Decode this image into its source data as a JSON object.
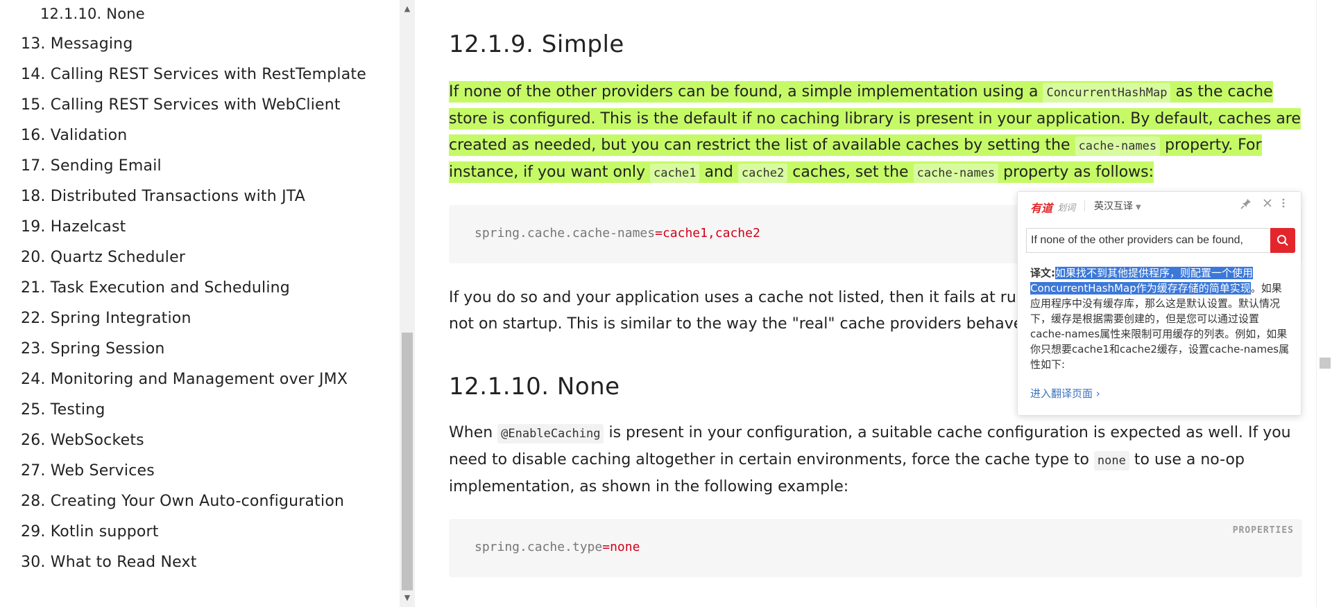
{
  "toc": {
    "items": [
      {
        "label": "12.1.10. None",
        "sub": true
      },
      {
        "label": "13. Messaging"
      },
      {
        "label": "14. Calling REST Services with RestTemplate"
      },
      {
        "label": "15. Calling REST Services with WebClient"
      },
      {
        "label": "16. Validation"
      },
      {
        "label": "17. Sending Email"
      },
      {
        "label": "18. Distributed Transactions with JTA"
      },
      {
        "label": "19. Hazelcast"
      },
      {
        "label": "20. Quartz Scheduler"
      },
      {
        "label": "21. Task Execution and Scheduling"
      },
      {
        "label": "22. Spring Integration"
      },
      {
        "label": "23. Spring Session"
      },
      {
        "label": "24. Monitoring and Management over JMX"
      },
      {
        "label": "25. Testing"
      },
      {
        "label": "26. WebSockets"
      },
      {
        "label": "27. Web Services"
      },
      {
        "label": "28. Creating Your Own Auto-configuration"
      },
      {
        "label": "29. Kotlin support"
      },
      {
        "label": "30. What to Read Next"
      }
    ]
  },
  "main": {
    "simple": {
      "heading": "12.1.9. Simple",
      "para1": {
        "t1": "If none of the other providers can be found, a simple implementation using a ",
        "c1": "ConcurrentHashMap",
        "t2": " as the cache store is configured. This is the default if no caching library is present in your application. By default, caches are created as needed, but you can restrict the list of available caches by setting the ",
        "c2": "cache-names",
        "t3": " property. For instance, if you want only ",
        "c3": "cache1",
        "t4": " and ",
        "c4": "cache2",
        "t5": " caches, set the ",
        "c5": "cache-names",
        "t6": " property as follows:"
      },
      "code": {
        "key": "spring.cache.cache-names",
        "eq": "=",
        "value": "cache1,cache2"
      },
      "para2": "If you do so and your application uses a cache not listed, then it fails at runtime when the cache is needed, but not on startup. This is similar to the way the \"real\" cache providers behave if you use an undeclared cache."
    },
    "none": {
      "heading": "12.1.10. None",
      "para": {
        "t1": "When ",
        "c1": "@EnableCaching",
        "t2": " is present in your configuration, a suitable cache configuration is expected as well. If you need to disable caching altogether in certain environments, force the cache type to ",
        "c2": "none",
        "t3": " to use a no-op implementation, as shown in the following example:"
      },
      "code": {
        "lang": "PROPERTIES",
        "key": "spring.cache.type",
        "eq": "=",
        "value": "none"
      }
    }
  },
  "popup": {
    "logo": "有道",
    "logo_sub": "划词",
    "mode": "英汉互译",
    "search_value": "If none of the other providers can be found,",
    "translation_label": "译文:",
    "translation_selected": "如果找不到其他提供程序，则配置一个使用ConcurrentHashMap作为缓存存储的简单实现",
    "translation_rest": "。如果应用程序中没有缓存库，那么这是默认设置。默认情况下，缓存是根据需要创建的，但是您可以通过设置cache-names属性来限制可用缓存的列表。例如，如果你只想要cache1和cache2缓存，设置cache-names属性如下:",
    "more_link": "进入翻译页面 ›"
  },
  "colors": {
    "highlight": "#c5fa66",
    "code_value": "#d0021b",
    "youdao_red": "#e3262c",
    "selection_blue": "#3c78d8",
    "link_blue": "#3a72c2"
  },
  "icons": {
    "pin": "pin-icon",
    "close": "close-icon",
    "more": "more-icon",
    "search": "search-icon"
  }
}
